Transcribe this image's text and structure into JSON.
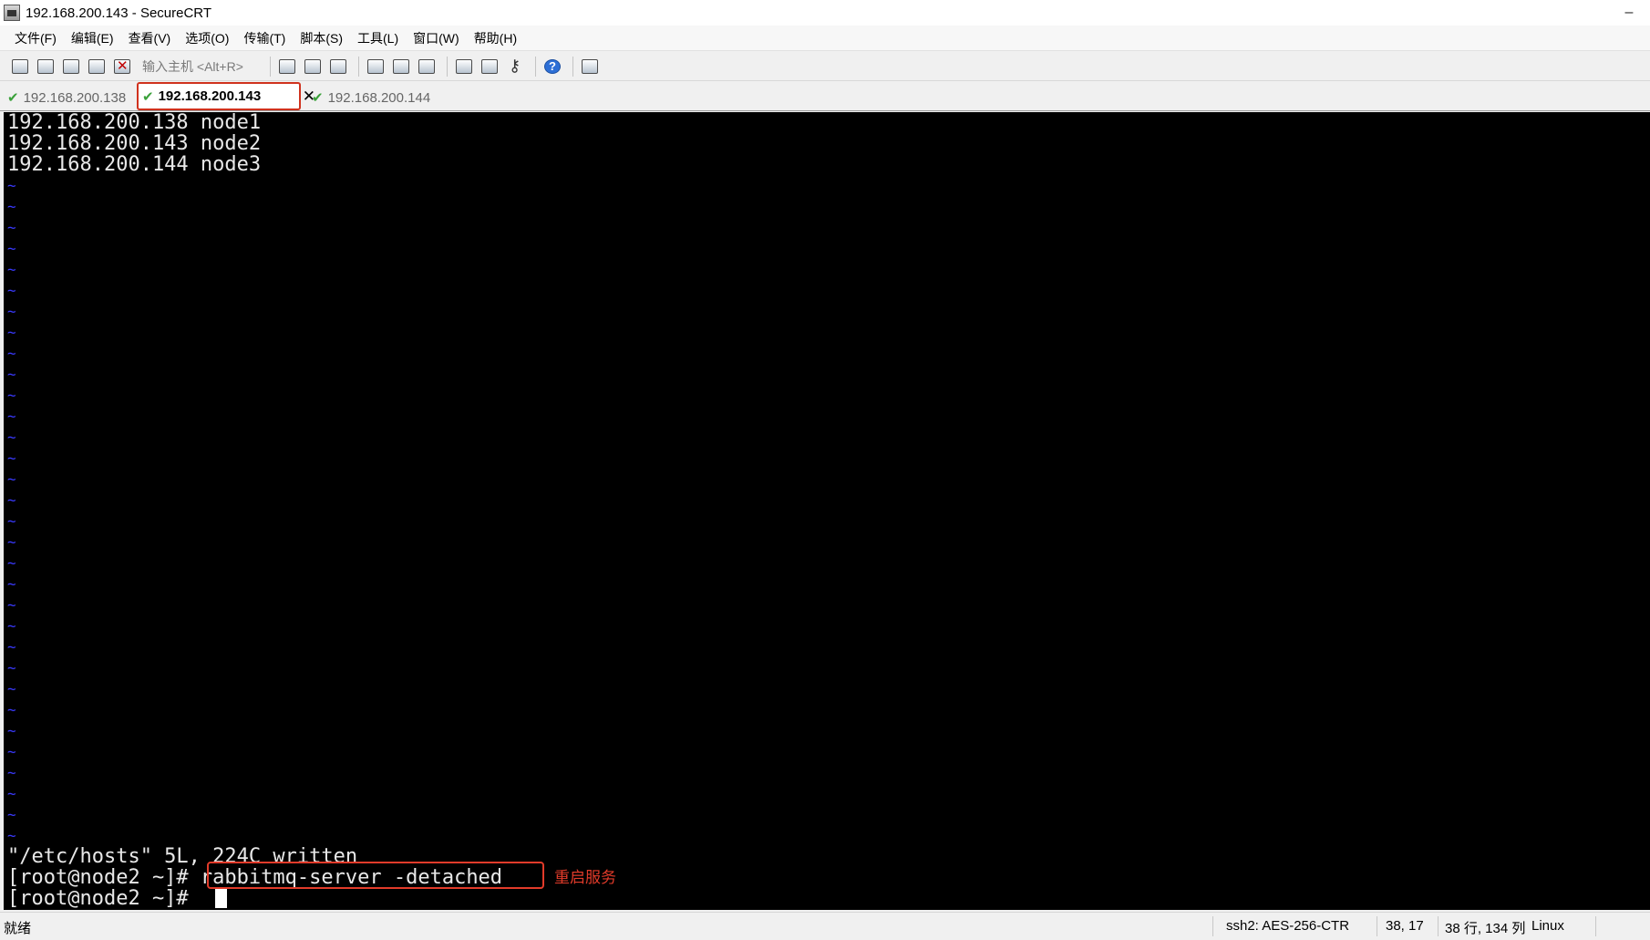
{
  "window": {
    "title": "192.168.200.143 - SecureCRT",
    "minimize_glyph": "–"
  },
  "menu": {
    "items": [
      "文件(F)",
      "编辑(E)",
      "查看(V)",
      "选项(O)",
      "传输(T)",
      "脚本(S)",
      "工具(L)",
      "窗口(W)",
      "帮助(H)"
    ]
  },
  "toolbar": {
    "quick_connect_placeholder": "输入主机 <Alt+R>",
    "icons": [
      "connect-icon",
      "quick-connect-icon",
      "connect-in-tab-icon",
      "reconnect-icon",
      "disconnect-icon",
      "copy-icon",
      "paste-icon",
      "find-icon",
      "print-icon",
      "print-selection-icon",
      "print-setup-icon",
      "session-options-icon",
      "global-options-icon",
      "keymap-icon",
      "help-icon",
      "sftp-icon"
    ]
  },
  "tabs": [
    {
      "label": "192.168.200.138",
      "active": false
    },
    {
      "label": "192.168.200.143",
      "active": true,
      "close": "✕"
    },
    {
      "label": "192.168.200.144",
      "active": false
    }
  ],
  "terminal": {
    "file_lines": [
      "192.168.200.138 node1",
      "192.168.200.143 node2",
      "192.168.200.144 node3"
    ],
    "tilde_char": "~",
    "write_message": "\"/etc/hosts\" 5L, 224C written",
    "prompt": "[root@node2 ~]# ",
    "command": "rabbitmq-server -detached",
    "annotation": "重启服务",
    "last_prompt": "[root@node2 ~]# "
  },
  "status": {
    "ready": "就绪",
    "encryption": "ssh2: AES-256-CTR",
    "cursor_pos": "38,  17",
    "dimensions": "38 行, 134 列",
    "os": "Linux"
  },
  "colors": {
    "terminal_bg": "#000000",
    "terminal_fg": "#e8e8e8",
    "tilde": "#3a3aff",
    "highlight": "#e23b2a"
  }
}
